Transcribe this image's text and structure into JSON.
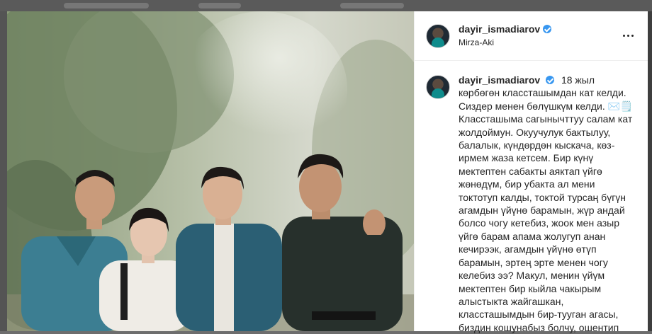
{
  "post": {
    "username": "dayir_ismadiarov",
    "location": "Mirza-Aki",
    "caption": "18 жыл көрбөгөн классташымдан кат келди. Сиздер менен бөлүшкүм келди. ✉️🗒️Классташыма сагынычттуу салам кат жолдоймун. Окуучулук бактылуу, балалык, күндөрдөн кыскача, көз-ирмем жаза кетсем. Бир күнү мектептен сабакты аяктап үйгө жөнөдүм, бир убакта ал мени токтотуп калды, токтой турсаң бүгүн агамдын үйүнө барамын, жүр андай болсо чогу кетебиз, жоок мен азыр үйгө барам апама жолугуп анан кечирээк, агамдын үйүнө өтүп барамын, эртең эрте менен чогу келебиз ээ? Макул, менин үйүм мектептен бир кыйла чакырым алыстыкта жайгашкан, классташымдын бир-тууган агасы, биздин кошунабыз болчу, ошентип"
  },
  "icons": {
    "verified": "verified-badge-icon",
    "more": "more-options-icon"
  },
  "colors": {
    "text": "#262626",
    "verified": "#3897f0",
    "overlay": "#6d6d6d"
  }
}
